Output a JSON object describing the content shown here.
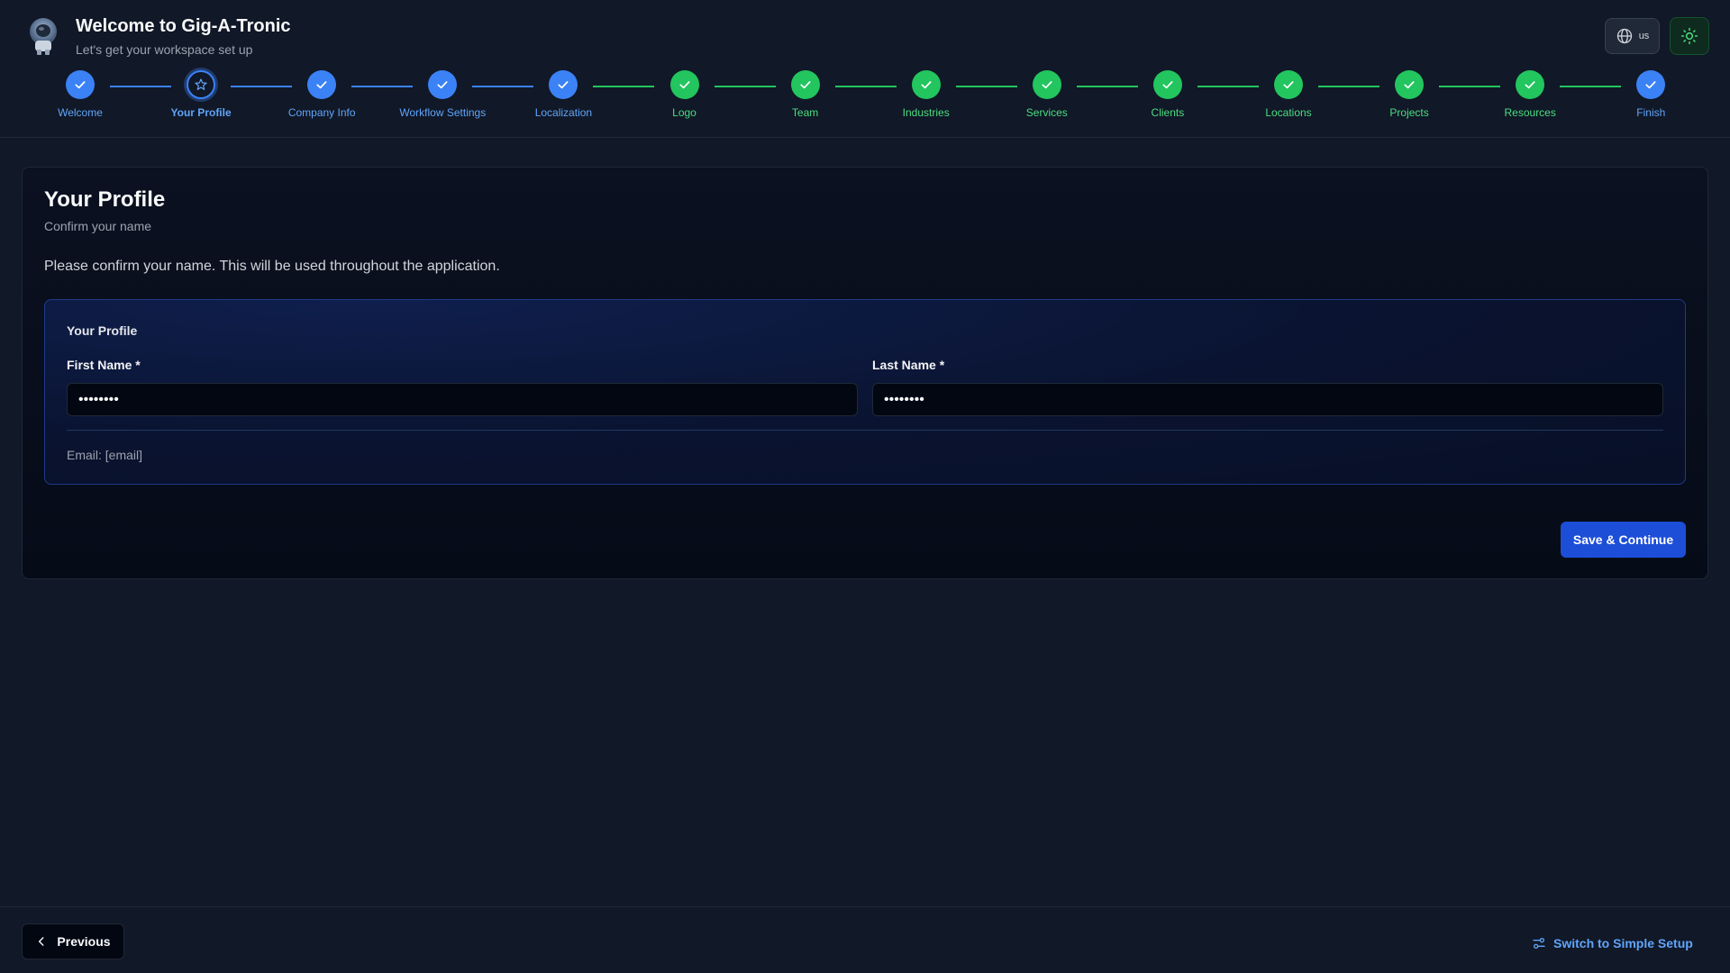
{
  "app": {
    "title": "Welcome to Gig-A-Tronic",
    "subtitle": "Let's get your workspace set up",
    "language_label": "us"
  },
  "icons": {
    "logo": "astronaut-avatar",
    "language": "globe-icon",
    "theme": "sun-icon",
    "step_done": "check-icon",
    "step_current": "star-icon",
    "previous": "chevron-left-icon",
    "simple_setup": "sliders-icon"
  },
  "colors": {
    "blue_step": "#3b82f6",
    "green_step": "#22c55e",
    "blue_label": "#60a5fa",
    "green_label": "#4ade80",
    "primary_button": "#1d4ed8"
  },
  "steps": [
    {
      "label": "Welcome",
      "state": "done",
      "color": "blue"
    },
    {
      "label": "Your Profile",
      "state": "current",
      "color": "blue"
    },
    {
      "label": "Company Info",
      "state": "done",
      "color": "blue"
    },
    {
      "label": "Workflow Settings",
      "state": "done",
      "color": "blue"
    },
    {
      "label": "Localization",
      "state": "done",
      "color": "blue"
    },
    {
      "label": "Logo",
      "state": "done",
      "color": "green"
    },
    {
      "label": "Team",
      "state": "done",
      "color": "green"
    },
    {
      "label": "Industries",
      "state": "done",
      "color": "green"
    },
    {
      "label": "Services",
      "state": "done",
      "color": "green"
    },
    {
      "label": "Clients",
      "state": "done",
      "color": "green"
    },
    {
      "label": "Locations",
      "state": "done",
      "color": "green"
    },
    {
      "label": "Projects",
      "state": "done",
      "color": "green"
    },
    {
      "label": "Resources",
      "state": "done",
      "color": "green"
    },
    {
      "label": "Finish",
      "state": "done",
      "color": "blue"
    }
  ],
  "card": {
    "title": "Your Profile",
    "subtitle": "Confirm your name",
    "description": "Please confirm your name. This will be used throughout the application.",
    "section_title": "Your Profile",
    "first_name_label": "First Name *",
    "first_name_value": "••••••••",
    "last_name_label": "Last Name *",
    "last_name_value": "••••••••",
    "email_text": "Email: [email]",
    "save_label": "Save & Continue"
  },
  "footer": {
    "previous_label": "Previous",
    "simple_setup_label": "Switch to Simple Setup"
  }
}
